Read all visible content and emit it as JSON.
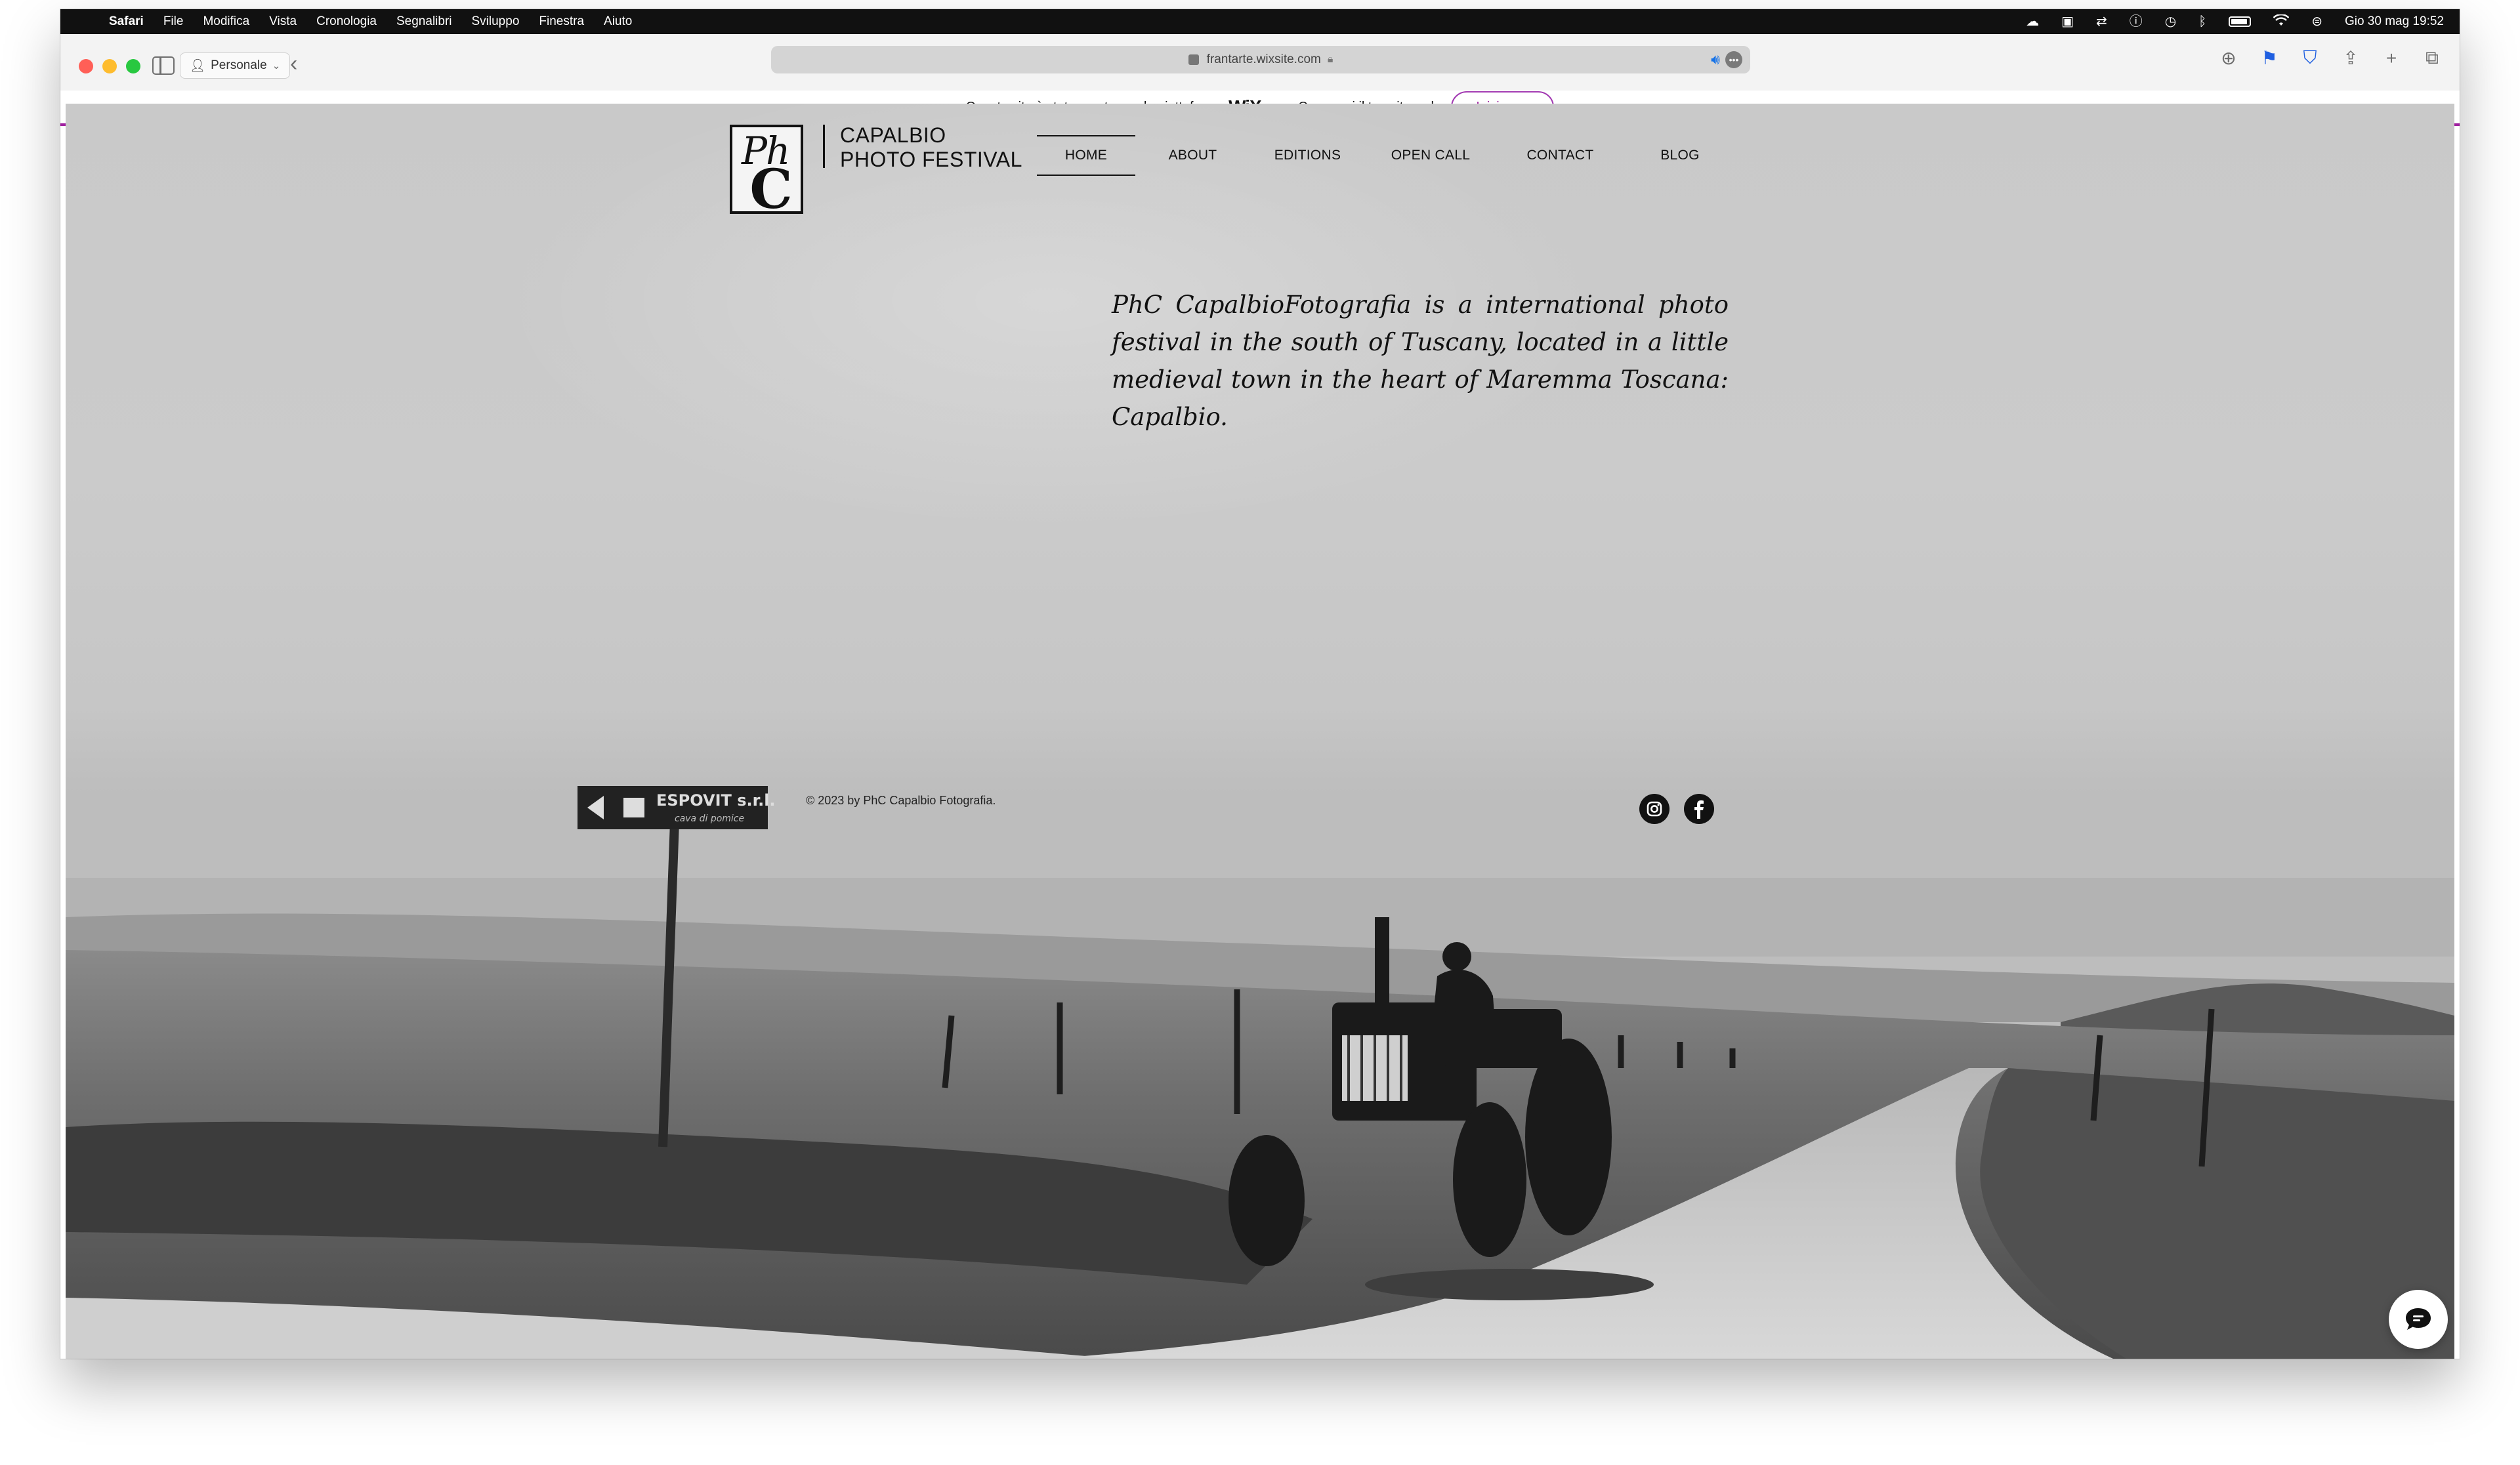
{
  "menubar": {
    "app_name": "Safari",
    "items": [
      "File",
      "Modifica",
      "Vista",
      "Cronologia",
      "Segnalibri",
      "Sviluppo",
      "Finestra",
      "Aiuto"
    ],
    "clock": "Gio 30 mag  19:52",
    "tray_icons": [
      "creative-cloud-icon",
      "display-icon",
      "sync-icon",
      "info-icon",
      "time-machine-icon",
      "bluetooth-icon",
      "battery-icon",
      "wifi-icon",
      "control-center-icon"
    ]
  },
  "toolbar": {
    "profile_label": "Personale",
    "url": "frantarte.wixsite.com"
  },
  "wix_banner": {
    "text_before": "Questo sito è stato creato con la piattaforma",
    "logo": "WiX",
    "text_after": ".com. Crea oggi il tuo sito web.",
    "cta_label": "Inizia ora"
  },
  "site": {
    "brand_line1": "CAPALBIO",
    "brand_line2": "PHOTO FESTIVAL",
    "logo_ph": "Ph",
    "logo_c": "C",
    "nav": [
      {
        "label": "HOME",
        "active": true
      },
      {
        "label": "ABOUT",
        "active": false
      },
      {
        "label": "EDITIONS",
        "active": false
      },
      {
        "label": "OPEN CALL",
        "active": false
      },
      {
        "label": "CONTACT",
        "active": false
      },
      {
        "label": "BLOG",
        "active": false
      }
    ],
    "intro": "PhC CapalbioFotografia is a international photo festival in the south of Tuscany, located in a little medieval town in the heart of Maremma Toscana: Capalbio.",
    "copyright": "© 2023 by PhC Capalbio Fotografia.",
    "sign_text": "ESPOVIT s.r.l.",
    "sign_subtext": "cava di pomice",
    "social": [
      "instagram-icon",
      "facebook-icon"
    ]
  },
  "colors": {
    "accent": "#a020a0",
    "menubar_bg": "#111111",
    "toolbar_bg": "#f3f3f3"
  }
}
